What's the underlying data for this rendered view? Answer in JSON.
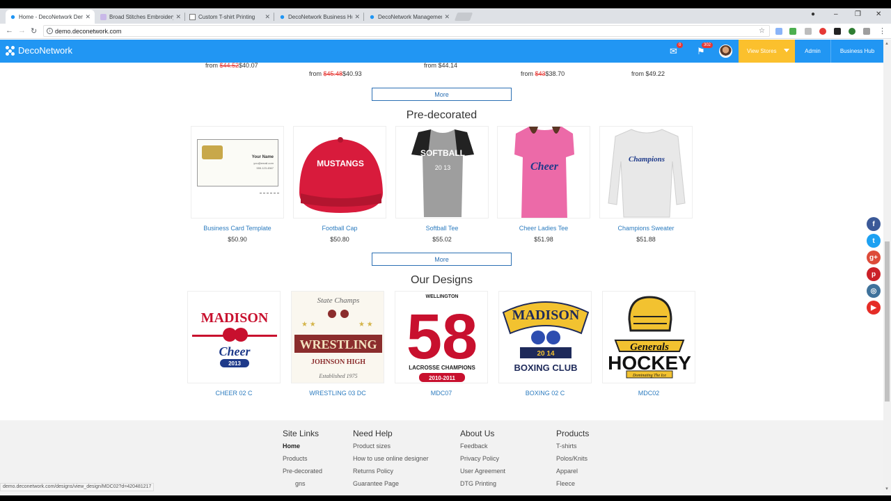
{
  "browser": {
    "tabs": [
      {
        "title": "Home - DecoNetwork Demo",
        "active": true
      },
      {
        "title": "Broad Stitches Embroidery",
        "active": false
      },
      {
        "title": "Custom T-shirt Printing",
        "active": false
      },
      {
        "title": "DecoNetwork Business Hub",
        "active": false
      },
      {
        "title": "DecoNetwork Management",
        "active": false
      }
    ],
    "url": "demo.deconetwork.com",
    "status_url": "demo.deconetwork.com/designs/view_design/MDC02?d=420481217"
  },
  "header": {
    "brand": "DecoNetwork",
    "messages_badge": "0",
    "notifications_badge": "302",
    "view_stores": "View Stores",
    "admin": "Admin",
    "business_hub": "Business Hub"
  },
  "top_prices": [
    {
      "prefix": "from",
      "old": "$44.52",
      "new": "$40.07"
    },
    {
      "prefix": "from",
      "old": "$45.48",
      "new": "$40.93"
    },
    {
      "prefix": "from",
      "old": "",
      "new": "$44.14"
    },
    {
      "prefix": "from",
      "old": "$43",
      "new": "$38.70"
    },
    {
      "prefix": "from",
      "old": "",
      "new": "$49.22"
    }
  ],
  "more_label": "More",
  "predecorated": {
    "title": "Pre-decorated",
    "items": [
      {
        "name": "Business Card Template",
        "price": "$50.90",
        "card_name": "Your Name",
        "card_email": "you@email.com",
        "card_phone": "555.123.4567"
      },
      {
        "name": "Football Cap",
        "price": "$50.80",
        "print": "MUSTANGS"
      },
      {
        "name": "Softball Tee",
        "price": "$55.02",
        "print": "SOFTBALL"
      },
      {
        "name": "Cheer Ladies Tee",
        "price": "$51.98",
        "print": "Cheer"
      },
      {
        "name": "Champions Sweater",
        "price": "$51.88",
        "print": "Champions"
      }
    ]
  },
  "designs": {
    "title": "Our Designs",
    "items": [
      {
        "name": "CHEER 02 C",
        "art_top": "MADISON",
        "art_mid": "Cheer",
        "art_year": "2013"
      },
      {
        "name": "WRESTLING 03 DC",
        "art_top": "State Champs",
        "art_mid": "WRESTLING",
        "art_sub": "JOHNSON HIGH",
        "art_year": "Established 1975"
      },
      {
        "name": "MDC07",
        "art_top": "WELLINGTON",
        "art_mid": "58",
        "art_sub": "LACROSSE CHAMPIONS",
        "art_year": "2010-2011"
      },
      {
        "name": "BOXING 02 C",
        "art_top": "MADISON",
        "art_year": "20 14",
        "art_sub": "BOXING CLUB"
      },
      {
        "name": "MDC02",
        "art_mid": "Generals",
        "art_sub": "HOCKEY",
        "art_year": "Dominating The Ice"
      }
    ]
  },
  "footer": {
    "columns": [
      {
        "title": "Site Links",
        "links": [
          "Home",
          "Products",
          "Pre-decorated",
          "gns"
        ]
      },
      {
        "title": "Need Help",
        "links": [
          "Product sizes",
          "How to use online designer",
          "Returns Policy",
          "Guarantee Page"
        ]
      },
      {
        "title": "About Us",
        "links": [
          "Feedback",
          "Privacy Policy",
          "User Agreement",
          "DTG Printing"
        ]
      },
      {
        "title": "Products",
        "links": [
          "T-shirts",
          "Polos/Knits",
          "Apparel",
          "Fleece"
        ]
      }
    ]
  },
  "social": [
    {
      "icon": "facebook-icon",
      "glyph": "f",
      "color": "#3b5998"
    },
    {
      "icon": "twitter-icon",
      "glyph": "t",
      "color": "#1da1f2"
    },
    {
      "icon": "google-plus-icon",
      "glyph": "g+",
      "color": "#dd4b39"
    },
    {
      "icon": "pinterest-icon",
      "glyph": "p",
      "color": "#cb2027"
    },
    {
      "icon": "instagram-icon",
      "glyph": "◎",
      "color": "#3f729b"
    },
    {
      "icon": "youtube-icon",
      "glyph": "▶",
      "color": "#e52d27"
    }
  ],
  "colors": {
    "header_blue": "#2196f3",
    "view_stores_yellow": "#fbc02d",
    "link_blue": "#2b7bbf",
    "sale_red": "#e53935"
  }
}
